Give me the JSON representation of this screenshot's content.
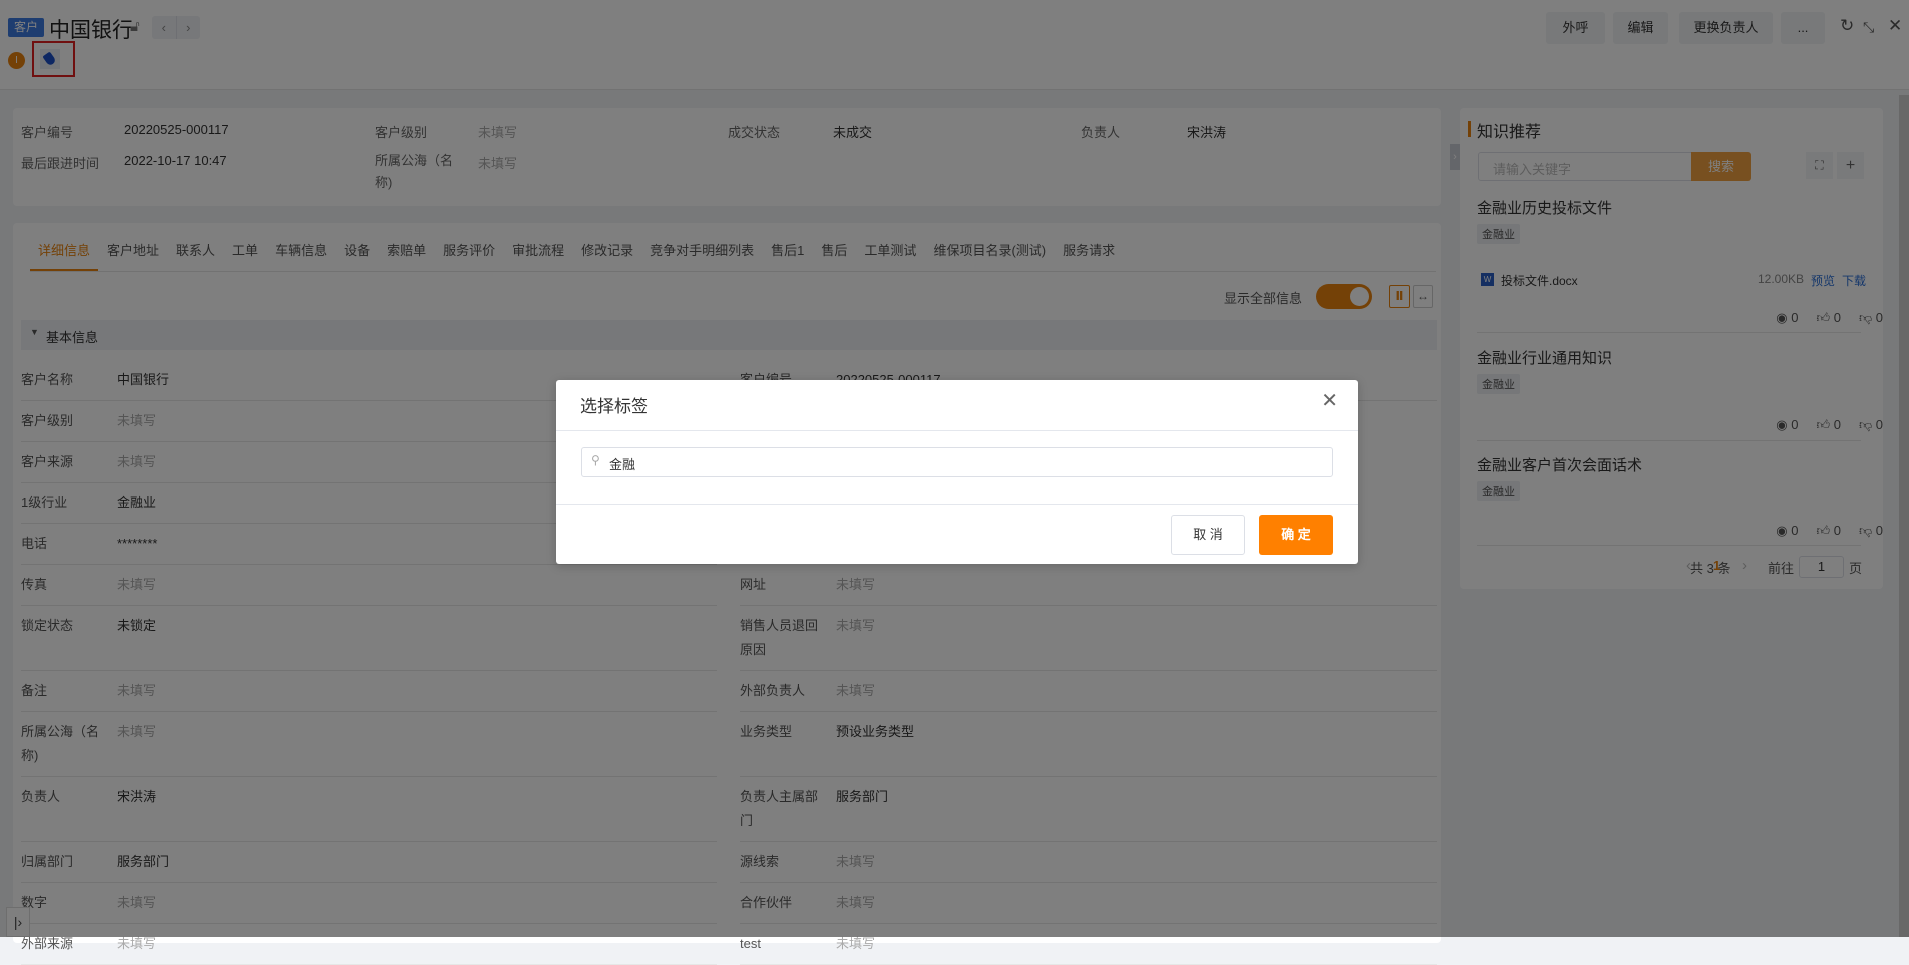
{
  "header": {
    "badge": "客户",
    "title": "中国银行",
    "prev": "‹",
    "next": "›",
    "buttons": [
      "外呼",
      "编辑",
      "更换负责人",
      "..."
    ]
  },
  "summary": [
    {
      "label": "客户编号",
      "value": "20220525-000117"
    },
    {
      "label": "客户级别",
      "value": "未填写"
    },
    {
      "label": "成交状态",
      "value": "未成交"
    },
    {
      "label": "负责人",
      "value": "宋洪涛"
    },
    {
      "label": "最后跟进时间",
      "value": "2022-10-17 10:47"
    },
    {
      "label": "所属公海（名称)",
      "value": "未填写"
    }
  ],
  "tabs": [
    "详细信息",
    "客户地址",
    "联系人",
    "工单",
    "车辆信息",
    "设备",
    "索赔单",
    "服务评价",
    "审批流程",
    "修改记录",
    "竞争对手明细列表",
    "售后1",
    "售后",
    "工单测试",
    "维保项目名录(测试)",
    "服务请求"
  ],
  "toggle": {
    "label": "显示全部信息",
    "on": true
  },
  "section": {
    "title": "基本信息"
  },
  "fields": [
    {
      "label": "客户名称",
      "value": "中国银行"
    },
    {
      "label": "客户编号",
      "value": "20220525-000117"
    },
    {
      "label": "客户级别",
      "value": "未填写"
    },
    {
      "label": "",
      "value": ""
    },
    {
      "label": "客户来源",
      "value": "未填写"
    },
    {
      "label": "",
      "value": ""
    },
    {
      "label": "1级行业",
      "value": "金融业"
    },
    {
      "label": "",
      "value": ""
    },
    {
      "label": "电话",
      "value": "********"
    },
    {
      "label": "",
      "value": ""
    },
    {
      "label": "传真",
      "value": "未填写"
    },
    {
      "label": "网址",
      "value": "未填写"
    },
    {
      "label": "锁定状态",
      "value": "未锁定"
    },
    {
      "label": "销售人员退回原因",
      "value": "未填写"
    },
    {
      "label": "备注",
      "value": "未填写"
    },
    {
      "label": "外部负责人",
      "value": "未填写"
    },
    {
      "label": "所属公海（名称)",
      "value": "未填写"
    },
    {
      "label": "业务类型",
      "value": "预设业务类型"
    },
    {
      "label": "负责人",
      "value": "宋洪涛"
    },
    {
      "label": "负责人主属部门",
      "value": "服务部门"
    },
    {
      "label": "归属部门",
      "value": "服务部门"
    },
    {
      "label": "源线索",
      "value": "未填写"
    },
    {
      "label": "数字",
      "value": "未填写"
    },
    {
      "label": "合作伙伴",
      "value": "未填写"
    },
    {
      "label": "外部来源",
      "value": "未填写"
    },
    {
      "label": "test",
      "value": "未填写"
    }
  ],
  "knowledge": {
    "title": "知识推荐",
    "search_placeholder": "请输入关键字",
    "search_button": "搜索",
    "items": [
      {
        "title": "金融业历史投标文件",
        "tag": "金融业",
        "file": {
          "name": "投标文件.docx",
          "size": "12.00KB",
          "preview": "预览",
          "download": "下载"
        },
        "views": "0",
        "likes": "0",
        "dislikes": "0"
      },
      {
        "title": "金融业行业通用知识",
        "tag": "金融业",
        "views": "0",
        "likes": "0",
        "dislikes": "0"
      },
      {
        "title": "金融业客户首次会面话术",
        "tag": "金融业",
        "views": "0",
        "likes": "0",
        "dislikes": "0"
      }
    ],
    "pagination": {
      "total": "共 3 条",
      "current": "1",
      "goto_label": "前往",
      "goto_value": "1",
      "page_suffix": "页"
    }
  },
  "modal": {
    "title": "选择标签",
    "search_value": "金融",
    "cancel": "取 消",
    "confirm": "确 定"
  },
  "colors": {
    "accent": "#ff8000",
    "badge": "#3d7be0"
  }
}
